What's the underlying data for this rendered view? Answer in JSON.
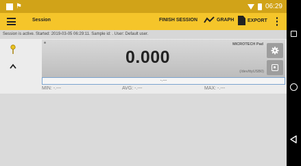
{
  "status_bar": {
    "time": "06:29",
    "icons": [
      "notification-square-icon",
      "flag-icon",
      "wifi-icon",
      "battery-icon"
    ]
  },
  "app_bar": {
    "title": "Session",
    "finish_label": "FINISH SESSION",
    "graph_label": "GRAPH",
    "export_label": "EXPORT",
    "icons": [
      "menu-icon",
      "graph-trend-icon",
      "document-icon",
      "more-vert-icon"
    ],
    "accent_color": "#f5c52a"
  },
  "session_info": "Session is active. Started: 2019-03-05 06:29:11. Sample id: . User: Default user.",
  "display": {
    "value": "0.000",
    "device_name": "MICROTECH Pad",
    "device_port": "(/dev/ttyUSB0)",
    "range_text": "-.---",
    "icons": [
      "probe-icon",
      "chevron-up-icon",
      "settings-icon",
      "camera-icon"
    ]
  },
  "stats": {
    "min": "MIN: -.---",
    "avg": "AVG: -.---",
    "max": "MAX: -.---"
  },
  "nav_bar": {
    "icons": [
      "recent-apps-icon",
      "home-icon",
      "back-icon"
    ]
  }
}
